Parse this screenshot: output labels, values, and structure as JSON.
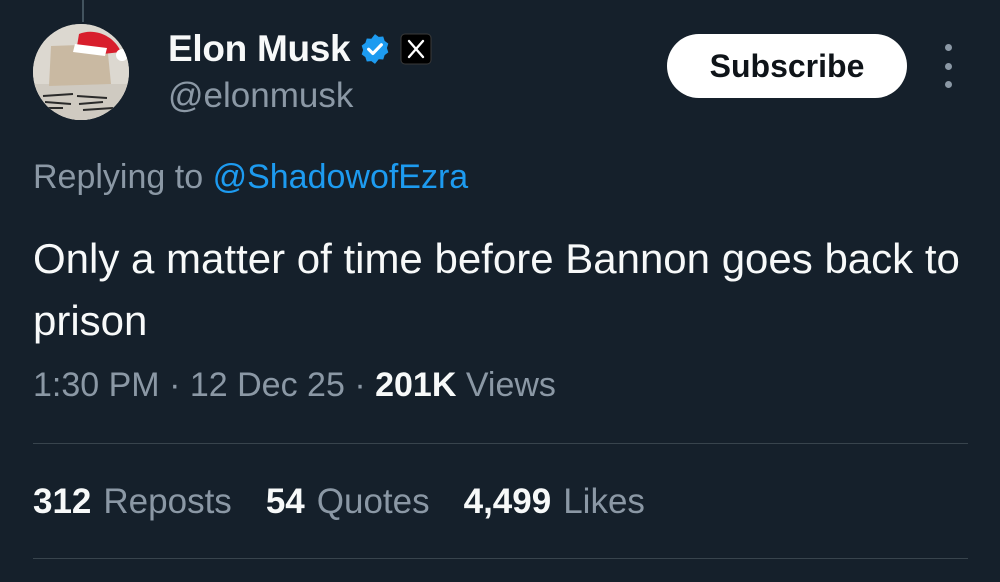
{
  "author": {
    "display_name": "Elon Musk",
    "handle": "@elonmusk",
    "verified": true,
    "affiliate_badge": "X"
  },
  "actions": {
    "subscribe_label": "Subscribe",
    "more_icon": "more-vertical-icon"
  },
  "reply": {
    "prefix": "Replying to",
    "mention": "@ShadowofEzra"
  },
  "tweet": {
    "text": "Only a matter of time before Bannon goes back to prison"
  },
  "meta": {
    "time": "1:30 PM",
    "separator": "·",
    "date": "12 Dec 25",
    "views_count": "201K",
    "views_label": "Views"
  },
  "stats": {
    "reposts_count": "312",
    "reposts_label": "Reposts",
    "quotes_count": "54",
    "quotes_label": "Quotes",
    "likes_count": "4,499",
    "likes_label": "Likes"
  },
  "colors": {
    "background": "#15202b",
    "primary_text": "#f7f9f9",
    "secondary_text": "#8b98a5",
    "accent": "#1d9bf0",
    "divider": "#38444d"
  }
}
